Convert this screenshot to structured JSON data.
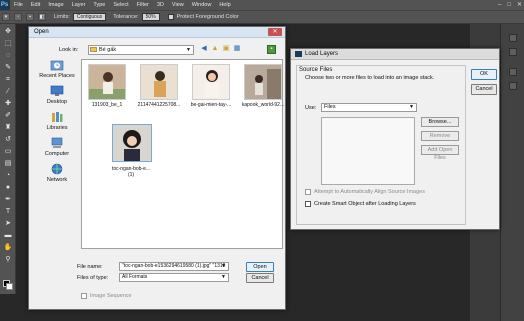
{
  "app": {
    "logo": "Ps",
    "menu": [
      "File",
      "Edit",
      "Image",
      "Layer",
      "Type",
      "Select",
      "Filter",
      "3D",
      "View",
      "Window",
      "Help"
    ],
    "window_controls": [
      "–",
      "□",
      "✕"
    ]
  },
  "options_bar": {
    "limits_label": "Limits:",
    "limits_value": "Contiguous",
    "tolerance_label": "Tolerance:",
    "tolerance_value": "50%",
    "protect_label": "Protect Foreground Color"
  },
  "open_dialog": {
    "title": "Open",
    "close": "✕",
    "look_in_label": "Look in:",
    "look_in_value": "Bé gấk",
    "places": [
      {
        "label": "Recent Places",
        "icon": "recent-places-icon"
      },
      {
        "label": "Desktop",
        "icon": "desktop-icon"
      },
      {
        "label": "Libraries",
        "icon": "libraries-icon"
      },
      {
        "label": "Computer",
        "icon": "computer-icon"
      },
      {
        "label": "Network",
        "icon": "network-icon"
      }
    ],
    "files": [
      {
        "name": "131903_be_1",
        "tone": "#cbb59a"
      },
      {
        "name": "211474412257​08...",
        "tone": "#d9b98e"
      },
      {
        "name": "be-gai-mien-tay-...",
        "tone": "#e8dccb"
      },
      {
        "name": "kapook_world-92...",
        "tone": "#b9a99a"
      },
      {
        "name": "toc-ngan-bob-e...\n(1)",
        "tone": "#3a3434"
      }
    ],
    "file_name_label": "File name:",
    "file_name_value": "\"toc-ngan-bob-e1536294619580 (1).jpg\" \"1319",
    "file_type_label": "Files of type:",
    "file_type_value": "All Formats",
    "open_label": "Open",
    "cancel_label": "Cancel",
    "image_sequence_label": "Image Sequence"
  },
  "load_layers": {
    "title": "Load Layers",
    "source_files_title": "Source Files",
    "source_files_desc": "Choose two or more files to load into an image stack.",
    "use_label": "Use:",
    "use_value": "Files",
    "browse_label": "Browse...",
    "remove_label": "Remove",
    "add_open_label": "Add Open Files",
    "align_label": "Attempt to Automatically Align Source Images",
    "smart_object_label": "Create Smart Object after Loading Layers",
    "ok_label": "OK",
    "cancel_label": "Cancel"
  }
}
